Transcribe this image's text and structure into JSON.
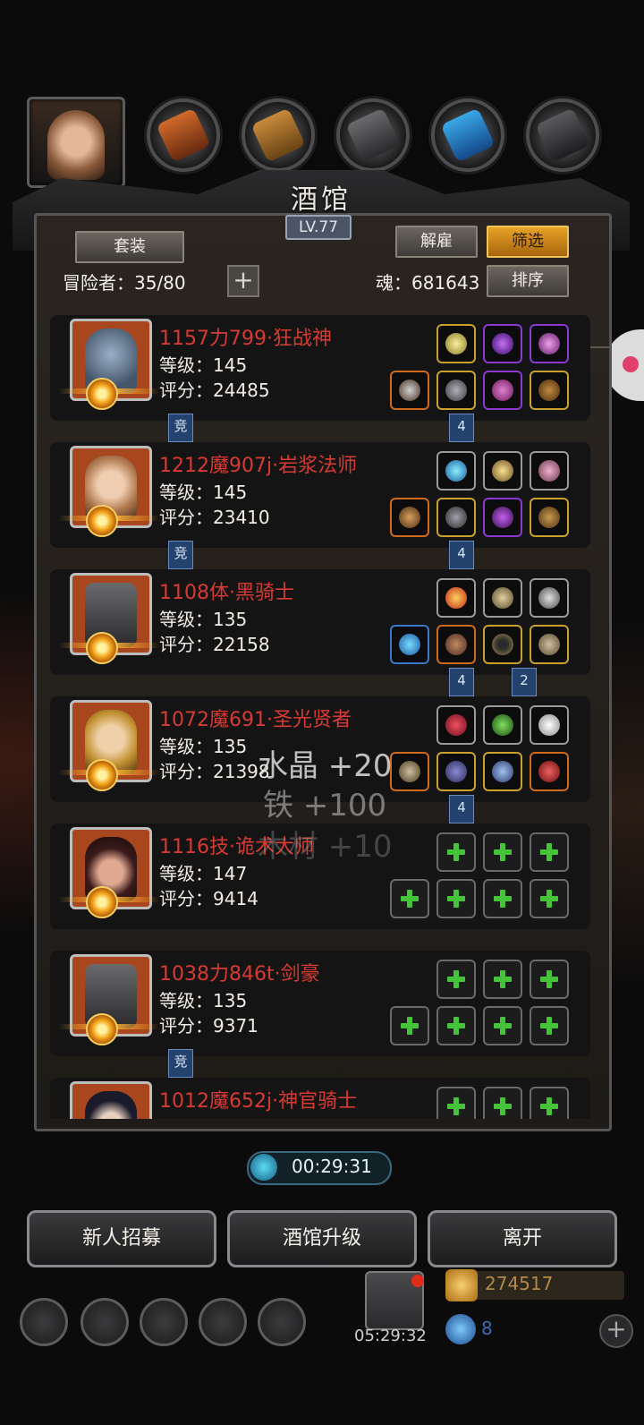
{
  "header": {
    "title": "酒馆",
    "level": "LV.77"
  },
  "toolbar": {
    "suit_label": "套装",
    "dismiss_label": "解雇",
    "filter_label": "筛选",
    "sort_label": "排序",
    "adventurers_label": "冒险者：35/80",
    "soul_label": "魂：681643",
    "add_symbol": "+"
  },
  "colors": {
    "name_red": "#d63a32",
    "accent_gold": "#e6a226",
    "empty_slot_plus": "#45c43a"
  },
  "adventurers": [
    {
      "name": "1157力799·狂战神",
      "level": "等级：145",
      "score": "评分：24485",
      "portrait": "demon-warrior-portrait"
    },
    {
      "name": "1212魔907j·岩浆法师",
      "level": "等级：145",
      "score": "评分：23410",
      "portrait": "mage-woman-portrait"
    },
    {
      "name": "1108体·黑骑士",
      "level": "等级：135",
      "score": "评分：22158",
      "portrait": "dark-knight-helmet-portrait"
    },
    {
      "name": "1072魔691·圣光贤者",
      "level": "等级：135",
      "score": "评分：21398",
      "portrait": "light-sage-portrait"
    },
    {
      "name": "1116技·诡术大师",
      "level": "等级：147",
      "score": "评分：9414",
      "portrait": "trickster-portrait"
    },
    {
      "name": "1038力846t·剑豪",
      "level": "等级：135",
      "score": "评分：9371",
      "portrait": "swordsman-helmet-portrait"
    },
    {
      "name": "1012魔652j·神官骑士",
      "level": "",
      "score": "",
      "portrait": "priest-knight-portrait"
    }
  ],
  "flags": {
    "arena": "竞",
    "four": "4",
    "two": "2"
  },
  "floating_rewards": [
    "水晶 +20",
    "铁 +100",
    "木材 +10"
  ],
  "timer": "00:29:31",
  "buttons": {
    "recruit": "新人招募",
    "upgrade": "酒馆升级",
    "leave": "离开"
  },
  "bottom": {
    "gift_timer": "05:29:32",
    "gold": "274517",
    "gems": "8",
    "add": "+"
  }
}
